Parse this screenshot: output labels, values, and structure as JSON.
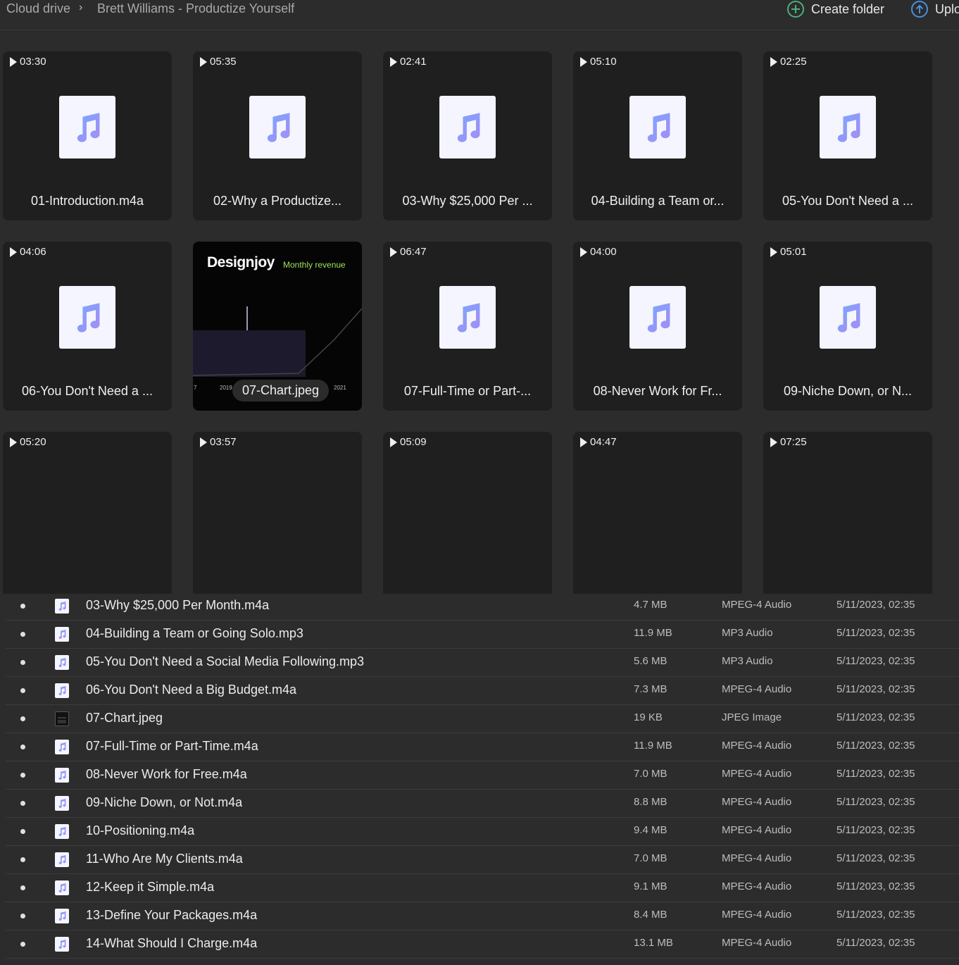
{
  "header": {
    "breadcrumb_root": "Cloud drive",
    "breadcrumb_sep": "›",
    "breadcrumb_folder": "Brett Williams - Productize Yourself",
    "create_folder_label": "Create folder",
    "upload_label": "Uplo"
  },
  "colors": {
    "note_icon": "#7aa7ff",
    "note_icon_alt": "#9f86f5",
    "create_icon": "#4caf7d",
    "upload_icon": "#4a90e2"
  },
  "tiles": [
    {
      "duration": "03:30",
      "name": "01-Introduction.m4a",
      "icon": "music-note-icon"
    },
    {
      "duration": "05:35",
      "name": "02-Why a Productize...",
      "icon": "music-note-icon"
    },
    {
      "duration": "02:41",
      "name": "03-Why $25,000 Per ...",
      "icon": "music-note-icon"
    },
    {
      "duration": "05:10",
      "name": "04-Building a Team or...",
      "icon": "music-note-icon"
    },
    {
      "duration": "02:25",
      "name": "05-You Don't Need a ...",
      "icon": "music-note-icon"
    },
    {
      "duration": "04:06",
      "name": "06-You Don't Need a ...",
      "icon": "music-note-icon"
    },
    {
      "duration": "",
      "name": "07-Chart.jpeg",
      "icon": "image-thumbnail",
      "brand": "Designjoy",
      "brand_sub": "Monthly revenue",
      "year_left": "2019",
      "year_right": "2021",
      "edge_mark": "7"
    },
    {
      "duration": "06:47",
      "name": "07-Full-Time or Part-...",
      "icon": "music-note-icon"
    },
    {
      "duration": "04:00",
      "name": "08-Never Work for Fr...",
      "icon": "music-note-icon"
    },
    {
      "duration": "05:01",
      "name": "09-Niche Down, or N...",
      "icon": "music-note-icon"
    },
    {
      "duration": "05:20",
      "name": "",
      "icon": "none"
    },
    {
      "duration": "03:57",
      "name": "",
      "icon": "none"
    },
    {
      "duration": "05:09",
      "name": "",
      "icon": "none"
    },
    {
      "duration": "04:47",
      "name": "",
      "icon": "none"
    },
    {
      "duration": "07:25",
      "name": "",
      "icon": "none"
    }
  ],
  "files": [
    {
      "name": "03-Why $25,000 Per Month.m4a",
      "size": "4.7 MB",
      "type": "MPEG-4 Audio",
      "date": "5/11/2023, 02:35",
      "icon": "audio-file-icon"
    },
    {
      "name": "04-Building a Team or Going Solo.mp3",
      "size": "11.9 MB",
      "type": "MP3 Audio",
      "date": "5/11/2023, 02:35",
      "icon": "audio-file-icon"
    },
    {
      "name": "05-You Don't Need a Social Media Following.mp3",
      "size": "5.6 MB",
      "type": "MP3 Audio",
      "date": "5/11/2023, 02:35",
      "icon": "audio-file-icon"
    },
    {
      "name": "06-You Don't Need a Big Budget.m4a",
      "size": "7.3 MB",
      "type": "MPEG-4 Audio",
      "date": "5/11/2023, 02:35",
      "icon": "audio-file-icon"
    },
    {
      "name": "07-Chart.jpeg",
      "size": "19 KB",
      "type": "JPEG Image",
      "date": "5/11/2023, 02:35",
      "icon": "image-file-icon"
    },
    {
      "name": "07-Full-Time or Part-Time.m4a",
      "size": "11.9 MB",
      "type": "MPEG-4 Audio",
      "date": "5/11/2023, 02:35",
      "icon": "audio-file-icon"
    },
    {
      "name": "08-Never Work for Free.m4a",
      "size": "7.0 MB",
      "type": "MPEG-4 Audio",
      "date": "5/11/2023, 02:35",
      "icon": "audio-file-icon"
    },
    {
      "name": "09-Niche Down, or Not.m4a",
      "size": "8.8 MB",
      "type": "MPEG-4 Audio",
      "date": "5/11/2023, 02:35",
      "icon": "audio-file-icon"
    },
    {
      "name": "10-Positioning.m4a",
      "size": "9.4 MB",
      "type": "MPEG-4 Audio",
      "date": "5/11/2023, 02:35",
      "icon": "audio-file-icon"
    },
    {
      "name": "11-Who Are My Clients.m4a",
      "size": "7.0 MB",
      "type": "MPEG-4 Audio",
      "date": "5/11/2023, 02:35",
      "icon": "audio-file-icon"
    },
    {
      "name": "12-Keep it Simple.m4a",
      "size": "9.1 MB",
      "type": "MPEG-4 Audio",
      "date": "5/11/2023, 02:35",
      "icon": "audio-file-icon"
    },
    {
      "name": "13-Define Your Packages.m4a",
      "size": "8.4 MB",
      "type": "MPEG-4 Audio",
      "date": "5/11/2023, 02:35",
      "icon": "audio-file-icon"
    },
    {
      "name": "14-What Should I Charge.m4a",
      "size": "13.1 MB",
      "type": "MPEG-4 Audio",
      "date": "5/11/2023, 02:35",
      "icon": "audio-file-icon"
    }
  ]
}
